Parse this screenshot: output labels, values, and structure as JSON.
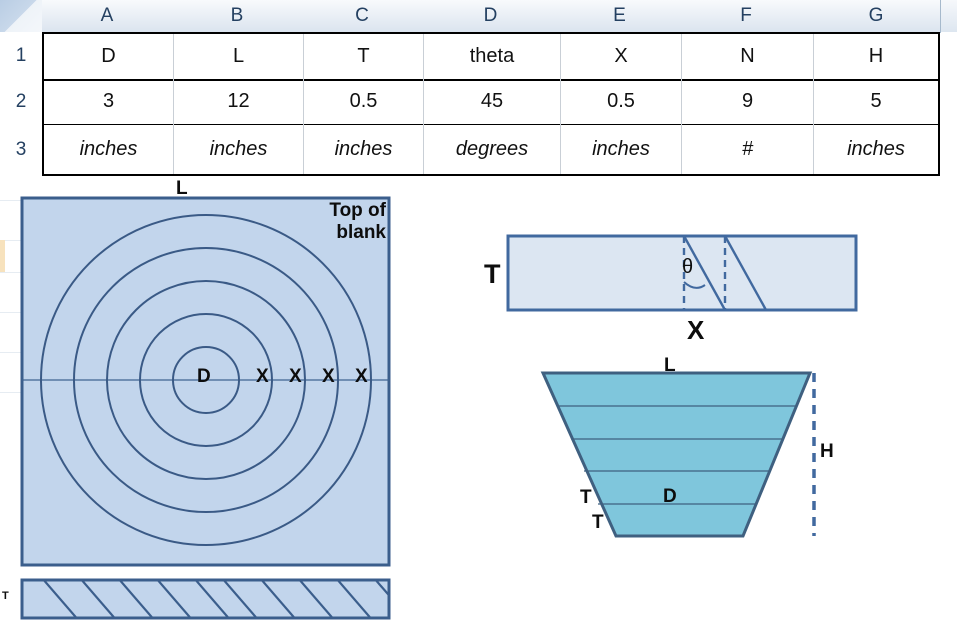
{
  "spreadsheet": {
    "column_headers": [
      "A",
      "B",
      "C",
      "D",
      "E",
      "F",
      "G"
    ],
    "row_headers": [
      "1",
      "2",
      "3"
    ],
    "rows": [
      [
        "D",
        "L",
        "T",
        "theta",
        "X",
        "N",
        "H"
      ],
      [
        "3",
        "12",
        "0.5",
        "45",
        "0.5",
        "9",
        "5"
      ],
      [
        "inches",
        "inches",
        "inches",
        "degrees",
        "inches",
        "#",
        "inches"
      ]
    ]
  },
  "diagrams": {
    "top_view": {
      "length_label": "L",
      "caption": "Top of\nblank",
      "caption_line1": "Top of",
      "caption_line2": "blank",
      "center_label": "D",
      "step_labels": [
        "X",
        "X",
        "X",
        "X"
      ],
      "num_circles": 5,
      "fill_color": "#c2d5ec",
      "line_color": "#3a5a86"
    },
    "side_bar": {
      "thickness_label": "T",
      "fill_color": "#c2d5ec",
      "line_color": "#3b5e8c",
      "hatch_count": 10
    },
    "angle_block": {
      "thickness_label": "T",
      "angle_label": "θ",
      "step_label": "X",
      "fill_color": "#dce6f2",
      "line_color": "#41699f"
    },
    "section_view": {
      "top_label": "L",
      "height_label": "H",
      "diameter_label": "D",
      "thickness_label_1": "T",
      "thickness_label_2": "T",
      "fill_color": "#7fc6dc",
      "line_color": "#3f6080",
      "num_steps": 5
    }
  }
}
